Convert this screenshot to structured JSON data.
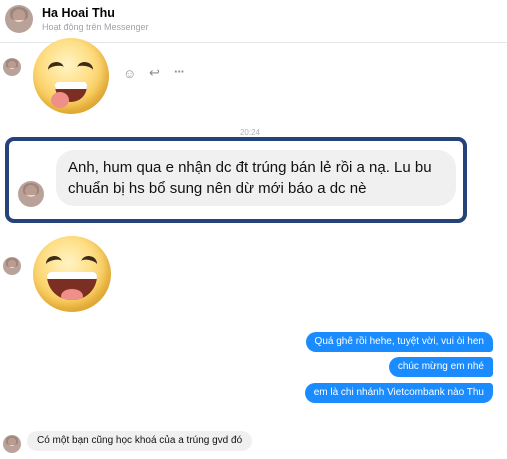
{
  "header": {
    "contact_name": "Ha Hoai Thu",
    "status": "Hoạt động trên Messenger"
  },
  "reactions": {
    "emoji_icon": "smile-icon",
    "reply_icon": "reply-icon",
    "more_icon": "more-icon",
    "emoji_glyph": "☺",
    "reply_glyph": "↩",
    "more_glyph": "···"
  },
  "timestamp": "20:24",
  "messages": {
    "highlighted": "Anh, hum qua e nhận dc đt trúng bán lẻ rồi a nạ. Lu bu chuẩn bị hs bổ sung nên dừ mới báo a dc nè",
    "outgoing": [
      "Quá ghê rồi hehe, tuyệt vời, vui òi hen",
      "chúc mừng em nhé",
      "em là chi nhánh Vietcombank nào Thu"
    ],
    "incoming_last": "Có một bạn cũng học khoá của a trúng gvd đó"
  },
  "colors": {
    "outgoing_bubble": "#1a8cff",
    "incoming_bubble": "#f0f0f0",
    "highlight_border": "#26427a"
  }
}
